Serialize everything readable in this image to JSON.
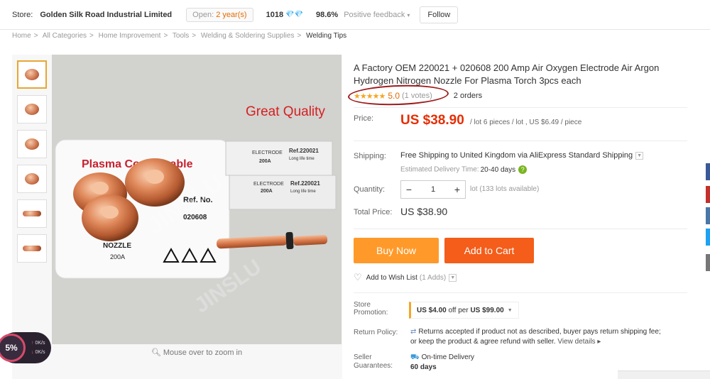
{
  "store_bar": {
    "store_label": "Store:",
    "store_name": "Golden Silk Road Industrial Limited",
    "open_prefix": "Open:",
    "open_years": "2 year(s)",
    "score": "1018",
    "diamonds": "💎💎",
    "positive_pct": "98.6%",
    "positive_label": "Positive feedback",
    "follow_label": "Follow"
  },
  "breadcrumb": [
    "Home",
    "All Categories",
    "Home Improvement",
    "Tools",
    "Welding & Soldering Supplies",
    "Welding Tips"
  ],
  "breadcrumb_sep": ">",
  "gallery": {
    "zoom_hint": "Mouse over to zoom in",
    "image_text": {
      "great_quality": "Great Quality",
      "plasma_consumable": "Plasma Consumable",
      "ref_no": "Ref. No.",
      "ref_code": "020608",
      "nozzle": "NOZZLE",
      "amps": "200A",
      "electrode": "ELECTRODE",
      "ref_220021": "Ref.220021",
      "long_life": "Long life time",
      "watermark": "JINSLU"
    }
  },
  "speed_widget": {
    "percent": "5%",
    "up_rate": "0K/s",
    "down_rate": "0K/s"
  },
  "product": {
    "title": "A Factory OEM 220021 + 020608 200 Amp Air Oxygen Electrode Air Argon Hydrogen Nitrogen Nozzle For Plasma Torch 3pcs each",
    "stars": "★★★★★",
    "rating": "5.0",
    "votes": "(1 votes)",
    "orders": "2 orders",
    "price_label": "Price:",
    "price": "US $38.90",
    "price_extra": "/ lot 6 pieces / lot , US $6.49 / piece",
    "shipping_label": "Shipping:",
    "shipping_value": "Free Shipping to United Kingdom via AliExpress Standard Shipping",
    "edt_label": "Estimated Delivery Time:",
    "edt_value": "20-40 days",
    "quantity_label": "Quantity:",
    "quantity_value": "1",
    "lots_available": "lot (133 lots available)",
    "total_label": "Total Price:",
    "total_value": "US $38.90",
    "buy_now": "Buy Now",
    "add_to_cart": "Add to Cart",
    "wish_label": "Add to Wish List",
    "wish_adds": "(1 Adds)",
    "promo_label_1": "Store",
    "promo_label_2": "Promotion:",
    "promo_text_a": "US $4.00",
    "promo_text_b": "off per",
    "promo_text_c": "US $99.00",
    "policy_label": "Return Policy:",
    "policy_line1": "Returns accepted if product not as described, buyer pays return shipping fee;",
    "policy_line2": "or keep the product & agree refund with seller.",
    "policy_more": "View details ▸",
    "guar_label_1": "Seller",
    "guar_label_2": "Guarantees:",
    "guar_line1": "On-time Delivery",
    "guar_line2": "60 days"
  },
  "colors": {
    "price_red": "#e62e04",
    "buy_now": "#ff9a2a",
    "add_to_cart": "#f45d1a",
    "star": "#f5a623",
    "annotation_circle": "#9e1b1b"
  }
}
